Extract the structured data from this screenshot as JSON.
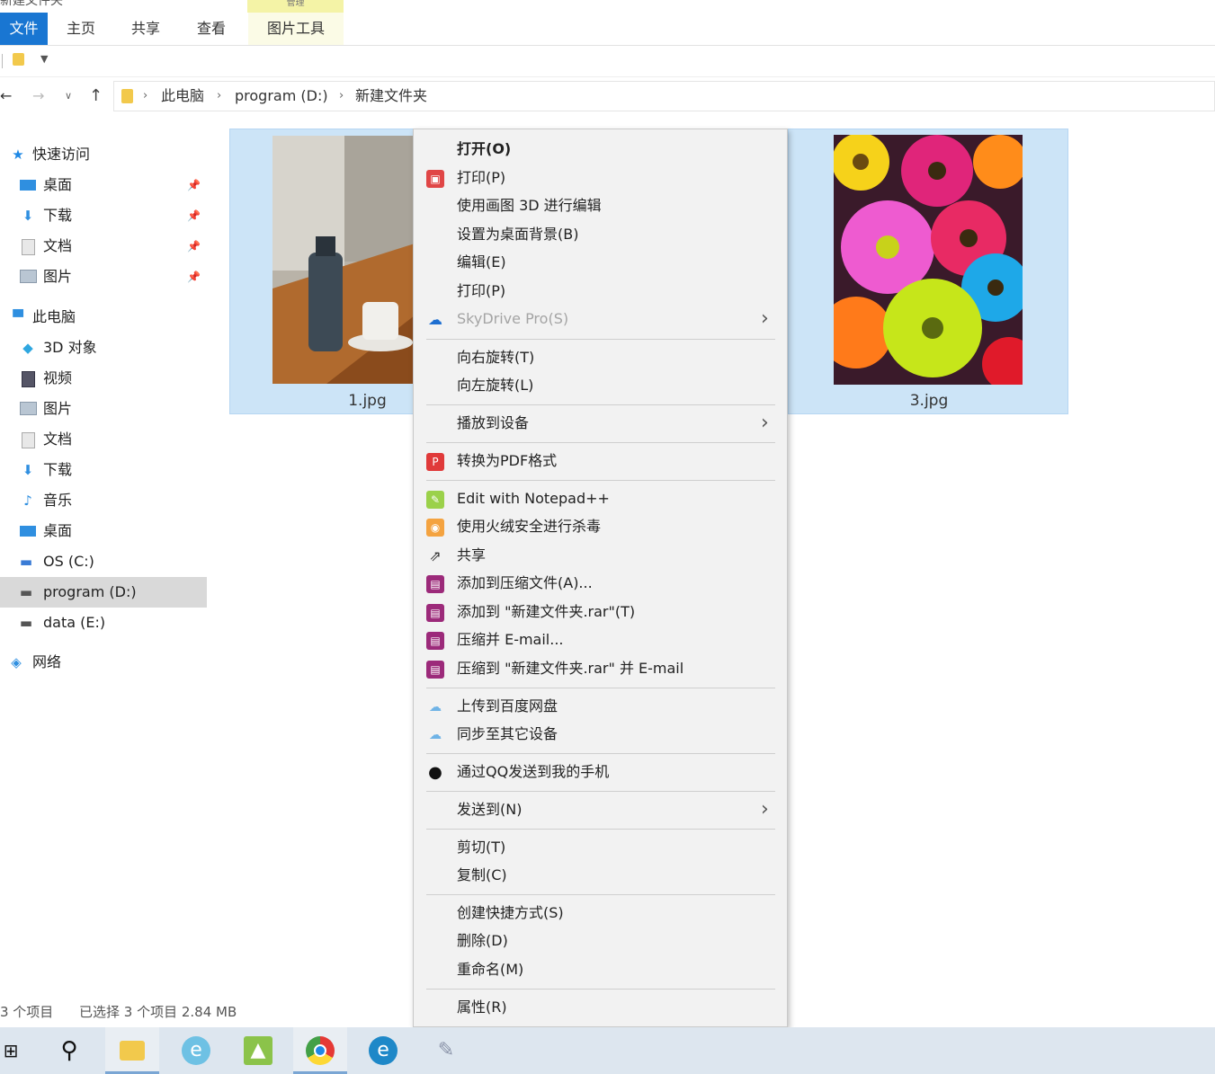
{
  "window": {
    "title": "新建文件夹",
    "context_tab_label": "管理"
  },
  "ribbon": {
    "tabs": [
      "文件",
      "主页",
      "共享",
      "查看",
      "图片工具"
    ],
    "active_tab": "文件"
  },
  "address": {
    "path": [
      "此电脑",
      "program (D:)",
      "新建文件夹"
    ]
  },
  "navpane": {
    "quick_access": {
      "label": "快速访问",
      "items": [
        {
          "label": "桌面",
          "icon": "desktop-icon",
          "pinned": true
        },
        {
          "label": "下载",
          "icon": "download-icon",
          "pinned": true
        },
        {
          "label": "文档",
          "icon": "document-icon",
          "pinned": true
        },
        {
          "label": "图片",
          "icon": "picture-icon",
          "pinned": true
        }
      ]
    },
    "this_pc": {
      "label": "此电脑",
      "items": [
        {
          "label": "3D 对象",
          "icon": "3d-objects-icon"
        },
        {
          "label": "视频",
          "icon": "video-icon"
        },
        {
          "label": "图片",
          "icon": "picture-icon"
        },
        {
          "label": "文档",
          "icon": "document-icon"
        },
        {
          "label": "下载",
          "icon": "download-icon"
        },
        {
          "label": "音乐",
          "icon": "music-icon"
        },
        {
          "label": "桌面",
          "icon": "desktop-icon"
        },
        {
          "label": "OS (C:)",
          "icon": "drive-icon"
        },
        {
          "label": "program (D:)",
          "icon": "drive-icon",
          "selected": true
        },
        {
          "label": "data (E:)",
          "icon": "drive-icon"
        }
      ]
    },
    "network": {
      "label": "网络",
      "icon": "network-icon"
    }
  },
  "files": [
    {
      "name": "1.jpg",
      "selected": true
    },
    {
      "name": "3.jpg",
      "selected": true
    }
  ],
  "context_menu": {
    "items": [
      {
        "label": "打开(O)",
        "bold": true
      },
      {
        "label": "打印(P)",
        "icon": "print-app-icon"
      },
      {
        "label": "使用画图 3D 进行编辑"
      },
      {
        "label": "设置为桌面背景(B)"
      },
      {
        "label": "编辑(E)"
      },
      {
        "label": "打印(P)"
      },
      {
        "label": "SkyDrive Pro(S)",
        "icon": "cloud-icon",
        "disabled": true,
        "submenu": true
      },
      {
        "label": "向右旋转(T)"
      },
      {
        "label": "向左旋转(L)"
      },
      {
        "label": "播放到设备",
        "submenu": true
      },
      {
        "label": "转换为PDF格式",
        "icon": "pdf-icon"
      },
      {
        "label": "Edit with Notepad++",
        "icon": "notepad-plus-icon"
      },
      {
        "label": "使用火绒安全进行杀毒",
        "icon": "huorong-shield-icon"
      },
      {
        "label": "共享",
        "icon": "share-icon"
      },
      {
        "label": "添加到压缩文件(A)...",
        "icon": "winrar-icon"
      },
      {
        "label": "添加到 \"新建文件夹.rar\"(T)",
        "icon": "winrar-icon"
      },
      {
        "label": "压缩并 E-mail...",
        "icon": "winrar-icon"
      },
      {
        "label": "压缩到 \"新建文件夹.rar\" 并 E-mail",
        "icon": "winrar-icon"
      },
      {
        "label": "上传到百度网盘",
        "icon": "baidu-cloud-icon"
      },
      {
        "label": "同步至其它设备",
        "icon": "baidu-cloud-icon"
      },
      {
        "label": "通过QQ发送到我的手机",
        "icon": "qq-icon"
      },
      {
        "label": "发送到(N)",
        "submenu": true
      },
      {
        "label": "剪切(T)"
      },
      {
        "label": "复制(C)"
      },
      {
        "label": "创建快捷方式(S)"
      },
      {
        "label": "删除(D)"
      },
      {
        "label": "重命名(M)"
      },
      {
        "label": "属性(R)"
      }
    ]
  },
  "status": {
    "item_count": "3 个项目",
    "selection": "已选择 3 个项目  2.84 MB"
  },
  "taskbar": {
    "icons": [
      "windows-start-icon",
      "search-icon",
      "file-explorer-icon",
      "browser-icon",
      "paint-icon",
      "chrome-icon",
      "edge-icon",
      "tool-icon"
    ]
  },
  "colors": {
    "accent": "#1976d2",
    "selection": "#cce4f7",
    "menu_bg": "#f2f2f2",
    "taskbar": "#dde6ef"
  }
}
